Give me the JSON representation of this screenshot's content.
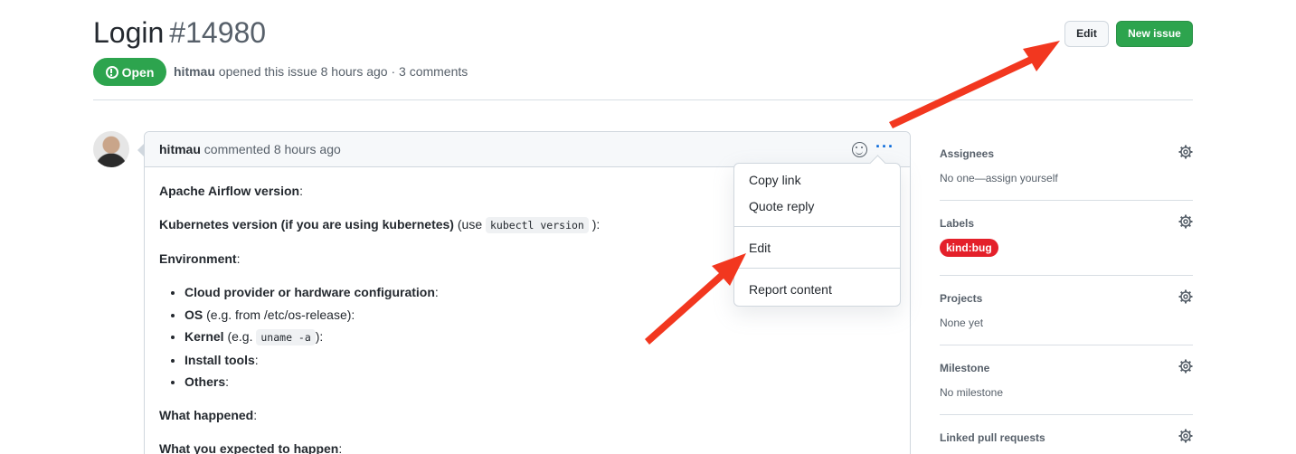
{
  "header": {
    "title": "Login",
    "number": "#14980",
    "edit_label": "Edit",
    "new_issue_label": "New issue"
  },
  "status": {
    "state": "Open",
    "author": "hitmau",
    "meta_text": "opened this issue 8 hours ago · 3 comments"
  },
  "comment": {
    "author": "hitmau",
    "meta": "commented 8 hours ago",
    "body": {
      "airflow_label": "Apache Airflow version",
      "kubernetes_label": "Kubernetes version (if you are using kubernetes)",
      "kubernetes_hint_pre": "(use",
      "kubernetes_code": "kubectl version",
      "kubernetes_hint_post": "):",
      "environment_label": "Environment",
      "env_items": [
        {
          "bold": "Cloud provider or hardware configuration",
          "rest": ":"
        },
        {
          "bold": "OS",
          "rest": " (e.g. from /etc/os-release):"
        },
        {
          "bold": "Kernel",
          "rest_pre": " (e.g. ",
          "code": "uname -a",
          "rest": "):"
        },
        {
          "bold": "Install tools",
          "rest": ":"
        },
        {
          "bold": "Others",
          "rest": ":"
        }
      ],
      "what_happened": "What happened",
      "what_expected": "What you expected to happen"
    }
  },
  "menu": {
    "copy_link": "Copy link",
    "quote_reply": "Quote reply",
    "edit": "Edit",
    "report": "Report content"
  },
  "sidebar": {
    "assignees": {
      "title": "Assignees",
      "value": "No one—assign yourself"
    },
    "labels": {
      "title": "Labels",
      "label": "kind:bug",
      "label_color": "#e4202a"
    },
    "projects": {
      "title": "Projects",
      "value": "None yet"
    },
    "milestone": {
      "title": "Milestone",
      "value": "No milestone"
    },
    "linked_prs": {
      "title": "Linked pull requests"
    }
  },
  "colors": {
    "open_green": "#2da44e",
    "annotation_red": "#f2371f",
    "link_blue": "#0969da"
  }
}
